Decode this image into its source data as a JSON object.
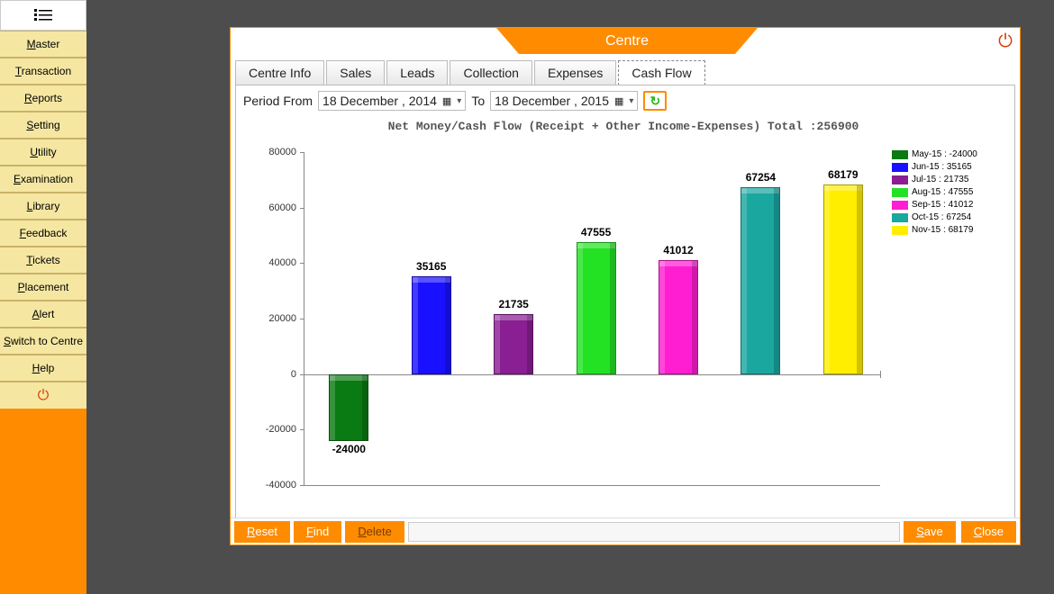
{
  "sidebar": {
    "items": [
      "Master",
      "Transaction",
      "Reports",
      "Setting",
      "Utility",
      "Examination",
      "Library",
      "Feedback",
      "Tickets",
      "Placement",
      "Alert",
      "Switch to Centre",
      "Help"
    ]
  },
  "window": {
    "title": "Centre"
  },
  "tabs": {
    "items": [
      "Centre Info",
      "Sales",
      "Leads",
      "Collection",
      "Expenses",
      "Cash Flow"
    ],
    "active": 5
  },
  "period": {
    "from_label": "Period From",
    "from_value": "18 December , 2014",
    "to_label": "To",
    "to_value": "18 December , 2015"
  },
  "buttons": {
    "reset": "Reset",
    "find": "Find",
    "delete": "Delete",
    "save": "Save",
    "close": "Close"
  },
  "chart_data": {
    "type": "bar",
    "title": "Net Money/Cash Flow (Receipt + Other Income-Expenses) Total :256900",
    "categories": [
      "May-15",
      "Jun-15",
      "Jul-15",
      "Aug-15",
      "Sep-15",
      "Oct-15",
      "Nov-15"
    ],
    "values": [
      -24000,
      35165,
      21735,
      47555,
      41012,
      67254,
      68179
    ],
    "colors": [
      "#0a7a12",
      "#1910ff",
      "#8a1e93",
      "#23e223",
      "#ff1ed2",
      "#1aa7a0",
      "#ffee00"
    ],
    "xlabel": "",
    "ylabel": "",
    "ylim": [
      -40000,
      80000
    ],
    "yticks": [
      -40000,
      -20000,
      0,
      20000,
      40000,
      60000,
      80000
    ],
    "legend_entries": [
      "May-15 : -24000",
      "Jun-15 : 35165",
      "Jul-15 : 21735",
      "Aug-15 : 47555",
      "Sep-15 : 41012",
      "Oct-15 : 67254",
      "Nov-15 : 68179"
    ]
  }
}
